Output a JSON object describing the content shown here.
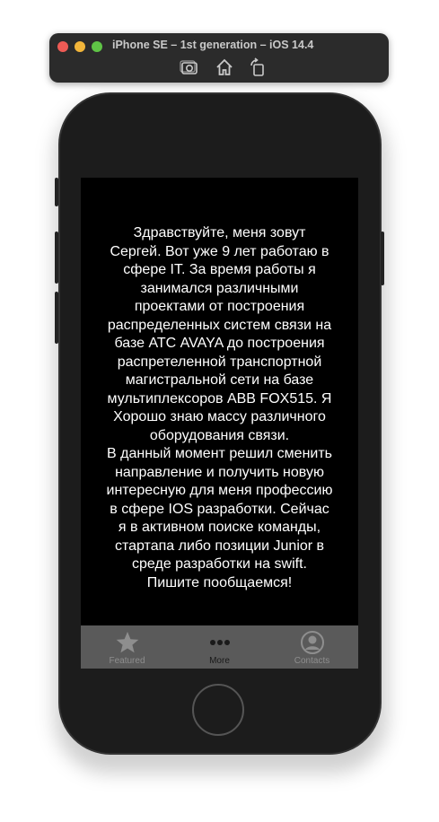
{
  "simulator": {
    "title": "iPhone SE – 1st generation – iOS 14.4",
    "tools": [
      "screenshot-icon",
      "home-icon",
      "rotate-icon"
    ]
  },
  "app": {
    "about_text": "Здравствуйте, меня зовут\nСергей. Вот уже 9 лет работаю в\nсфере IT. За время работы я\nзанимался различными\nпроектами от построения\nраспределенных систем связи на\nбазе АТС AVAYA до построения\nраспретеленной транспортной\nмагистральной сети на базе\nмультиплексоров ABB FOX515. Я\nХорошо знаю массу различного\nоборудования связи.\nВ данный момент решил сменить\nнаправление и получить новую\nинтересную для меня профессию\nв сфере IOS разработки. Сейчас\nя в активном поиске команды,\nстартапа либо позиции Junior в\nсреде разработки на swift.\nПишите пообщаемся!",
    "tabbar": {
      "items": [
        {
          "label": "Featured",
          "icon": "star-icon",
          "selected": false
        },
        {
          "label": "More",
          "icon": "more-dots-icon",
          "selected": true
        },
        {
          "label": "Contacts",
          "icon": "contacts-icon",
          "selected": false
        }
      ]
    }
  },
  "colors": {
    "screen_bg": "#000000",
    "text": "#ffffff",
    "tabbar_bg": "#5a5a5a",
    "tab_inactive": "#8e8e8e",
    "tab_active": "#1a1a1a"
  }
}
